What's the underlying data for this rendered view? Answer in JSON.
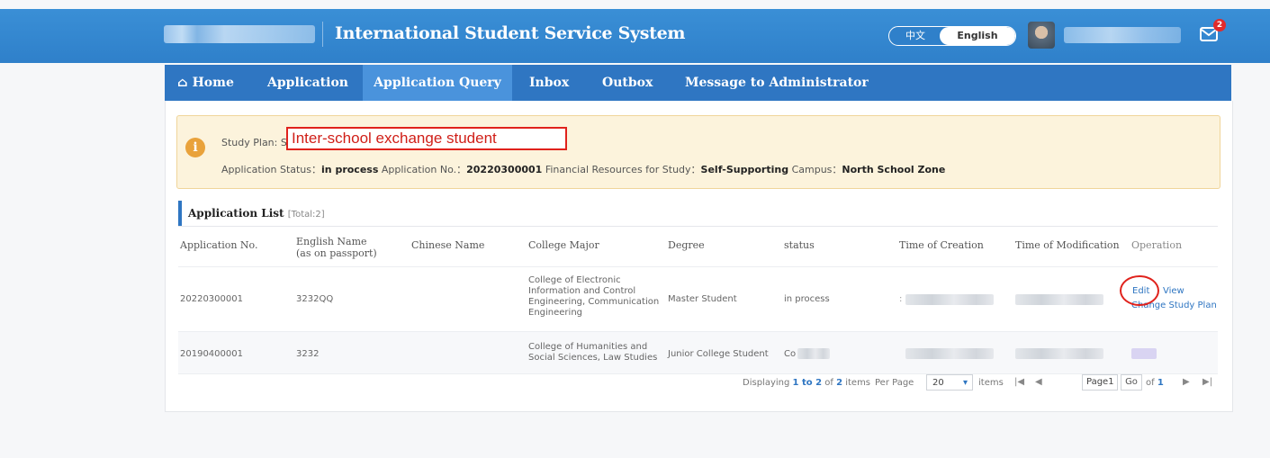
{
  "header": {
    "title": "International Student Service System",
    "lang_zh": "中文",
    "lang_en": "English",
    "mail_badge": "2"
  },
  "nav": {
    "home": "Home",
    "application": "Application",
    "application_query": "Application Query",
    "inbox": "Inbox",
    "outbox": "Outbox",
    "message_admin": "Message to Administrator"
  },
  "notice": {
    "study_plan_label": "Study Plan: S",
    "study_plan_value": "Inter-school exchange student",
    "status_label": "Application Status：",
    "status_value": "in process",
    "app_no_label": "Application No.：",
    "app_no_value": "20220300001",
    "financial_label": "Financial Resources for Study：",
    "financial_value": "Self-Supporting",
    "campus_label": "Campus：",
    "campus_value": "North School Zone"
  },
  "list": {
    "title": "Application List",
    "total": "[Total:2]",
    "headers": {
      "app_no": "Application No.",
      "english_name_1": "English Name",
      "english_name_2": "(as on passport)",
      "chinese_name": "Chinese Name",
      "college_major": "College Major",
      "degree": "Degree",
      "status": "status",
      "time_creation": "Time of Creation",
      "time_modification": "Time of Modification",
      "operation": "Operation"
    },
    "rows": [
      {
        "app_no": "20220300001",
        "english_name": "3232QQ",
        "major_1": "College of Electronic",
        "major_2": "Information and Control",
        "major_3": "Engineering, Communication",
        "major_4": "Engineering",
        "degree": "Master Student",
        "status": "in process",
        "op_edit": "Edit",
        "op_view": "View",
        "op_change": "Change Study Plan"
      },
      {
        "app_no": "20190400001",
        "english_name": "3232",
        "major_1": "College of Humanities and",
        "major_2": "Social Sciences, Law Studies",
        "degree": "Junior College Student",
        "status": "Co"
      }
    ]
  },
  "pager": {
    "displaying": "Displaying",
    "range": "1 to 2",
    "of": "of",
    "total": "2",
    "items": "items",
    "per_page": "Per Page",
    "per_page_value": "20",
    "items2": "items",
    "page_label": "Page",
    "page_value": "1",
    "go": "Go",
    "of2": "of",
    "total_pages": "1"
  }
}
